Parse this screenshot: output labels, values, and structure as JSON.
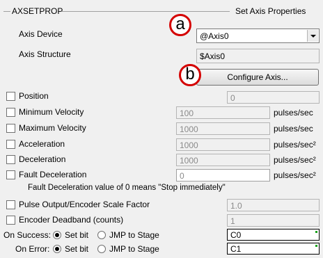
{
  "group": {
    "left_title": "AXSETPROP",
    "right_title": "Set Axis Properties"
  },
  "axis_device": {
    "label": "Axis Device",
    "value": "@Axis0"
  },
  "axis_structure": {
    "label": "Axis Structure",
    "value": "$Axis0"
  },
  "configure_button": {
    "label": "Configure Axis..."
  },
  "callouts": {
    "a": "a",
    "b": "b"
  },
  "rows": {
    "position": {
      "label": "Position",
      "value": "0",
      "unit": ""
    },
    "min_velocity": {
      "label": "Minimum Velocity",
      "value": "100",
      "unit": "pulses/sec"
    },
    "max_velocity": {
      "label": "Maximum Velocity",
      "value": "1000",
      "unit": "pulses/sec"
    },
    "acceleration": {
      "label": "Acceleration",
      "value": "1000",
      "unit": "pulses/sec²"
    },
    "deceleration": {
      "label": "Deceleration",
      "value": "1000",
      "unit": "pulses/sec²"
    },
    "fault_decel": {
      "label": "Fault Deceleration",
      "value": "0",
      "unit": "pulses/sec²"
    },
    "scale_factor": {
      "label": "Pulse Output/Encoder Scale Factor",
      "value": "1.0"
    },
    "deadband": {
      "label": "Encoder Deadband (counts)",
      "value": "1"
    }
  },
  "fault_note": "Fault Deceleration value of 0 means \"Stop immediately\"",
  "on_success": {
    "label": "On Success:",
    "opt1": "Set bit",
    "opt2": "JMP to Stage",
    "value": "C0"
  },
  "on_error": {
    "label": "On Error:",
    "opt1": "Set bit",
    "opt2": "JMP to Stage",
    "value": "C1"
  }
}
